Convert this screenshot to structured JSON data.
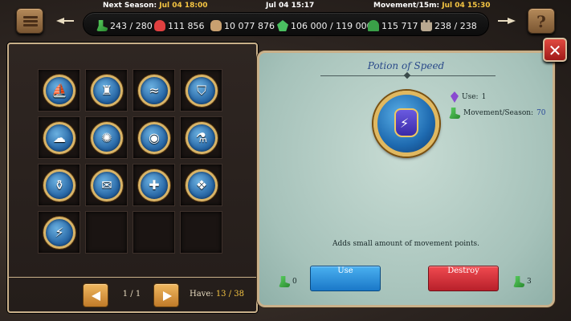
{
  "topbar": {
    "next_season_label": "Next Season:",
    "next_season_time": "Jul 04 18:00",
    "current_time": "Jul 04 15:17",
    "movement_label": "Movement/15m:",
    "movement_time": "Jul 04 15:30",
    "resources": [
      {
        "icon": "boot-icon",
        "value": "243 / 280"
      },
      {
        "icon": "heart-icon",
        "value": "111 856"
      },
      {
        "icon": "money-bag-icon",
        "value": "10 077 876"
      },
      {
        "icon": "gem-icon",
        "value": "106 000 / 119 000"
      },
      {
        "icon": "hat-icon",
        "value": "115 717"
      },
      {
        "icon": "castle-icon",
        "value": "238 / 238"
      }
    ],
    "help_label": "?"
  },
  "inventory": {
    "items": [
      {
        "name": "ship-item",
        "glyph": "⛵"
      },
      {
        "name": "armor-item",
        "glyph": "♜"
      },
      {
        "name": "carpet-item",
        "glyph": "≈"
      },
      {
        "name": "shield-item",
        "glyph": "⛉"
      },
      {
        "name": "ghost-item",
        "glyph": "☁"
      },
      {
        "name": "compass-item",
        "glyph": "✺"
      },
      {
        "name": "eye-item",
        "glyph": "◉"
      },
      {
        "name": "green-potion-item",
        "glyph": "⚗"
      },
      {
        "name": "brown-potion-item",
        "glyph": "⚱"
      },
      {
        "name": "scroll-item",
        "glyph": "✉"
      },
      {
        "name": "heal-potion-item",
        "glyph": "✚"
      },
      {
        "name": "cloth-item",
        "glyph": "❖"
      },
      {
        "name": "potion-of-speed-item",
        "glyph": "⚡"
      }
    ],
    "page": "1 / 1",
    "have_label": "Have:",
    "have_value": "13 / 38"
  },
  "detail": {
    "title": "Potion of Speed",
    "use_label": "Use:",
    "use_value": "1",
    "movement_label": "Movement/Season:",
    "movement_value": "70",
    "description": "Adds small amount of movement points.",
    "use_button": "Use",
    "destroy_button": "Destroy",
    "use_cost": "0",
    "destroy_gain": "3"
  },
  "colors": {
    "highlight": "#f5c542",
    "use_button": "#2a8ad8",
    "destroy_button": "#d8303a"
  }
}
